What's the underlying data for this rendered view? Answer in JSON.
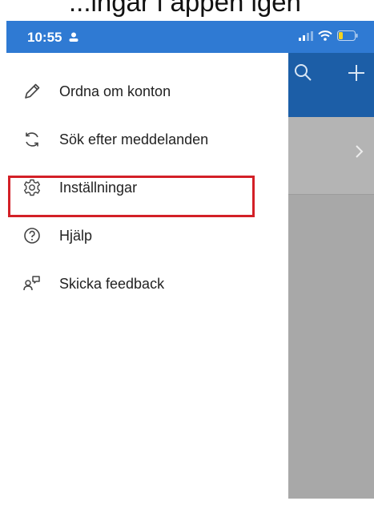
{
  "caption": "...ingar i appen igen",
  "statusbar": {
    "time": "10:55"
  },
  "menu": {
    "items": [
      {
        "icon": "pencil-icon",
        "label": "Ordna om konton"
      },
      {
        "icon": "refresh-icon",
        "label": "Sök efter meddelanden"
      },
      {
        "icon": "gear-icon",
        "label": "Inställningar"
      },
      {
        "icon": "help-icon",
        "label": "Hjälp"
      },
      {
        "icon": "feedback-icon",
        "label": "Skicka feedback"
      }
    ]
  },
  "background": {
    "header_icons": [
      "search-icon",
      "plus-icon"
    ],
    "row_icon": "chevron-right-icon"
  },
  "colors": {
    "statusbar": "#2f7ad3",
    "app_header": "#1c5ea7",
    "highlight": "#d32027"
  }
}
